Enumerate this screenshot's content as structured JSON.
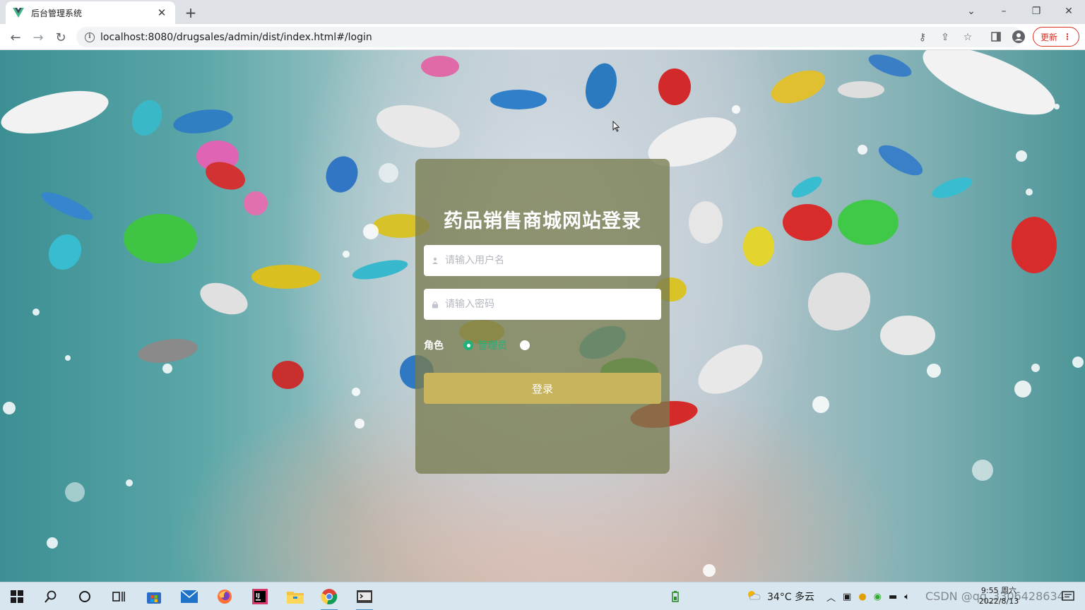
{
  "browser": {
    "tab_title": "后台管理系统",
    "url": "localhost:8080/drugsales/admin/dist/index.html#/login",
    "update_label": "更新"
  },
  "login": {
    "title": "药品销售商城网站登录",
    "username_placeholder": "请输入用户名",
    "password_placeholder": "请输入密码",
    "role_label": "角色",
    "role_options": [
      "管理员",
      ""
    ],
    "selected_role": "管理员",
    "submit_label": "登录"
  },
  "taskbar": {
    "weather": "34°C  多云",
    "time": "9:55 周六",
    "date": "2022/8/13",
    "watermark": "CSDN @qq_3306428634"
  },
  "colors": {
    "accent_green": "#23b07a",
    "login_button": "#c8b45c",
    "card_bg": "#787c50"
  }
}
